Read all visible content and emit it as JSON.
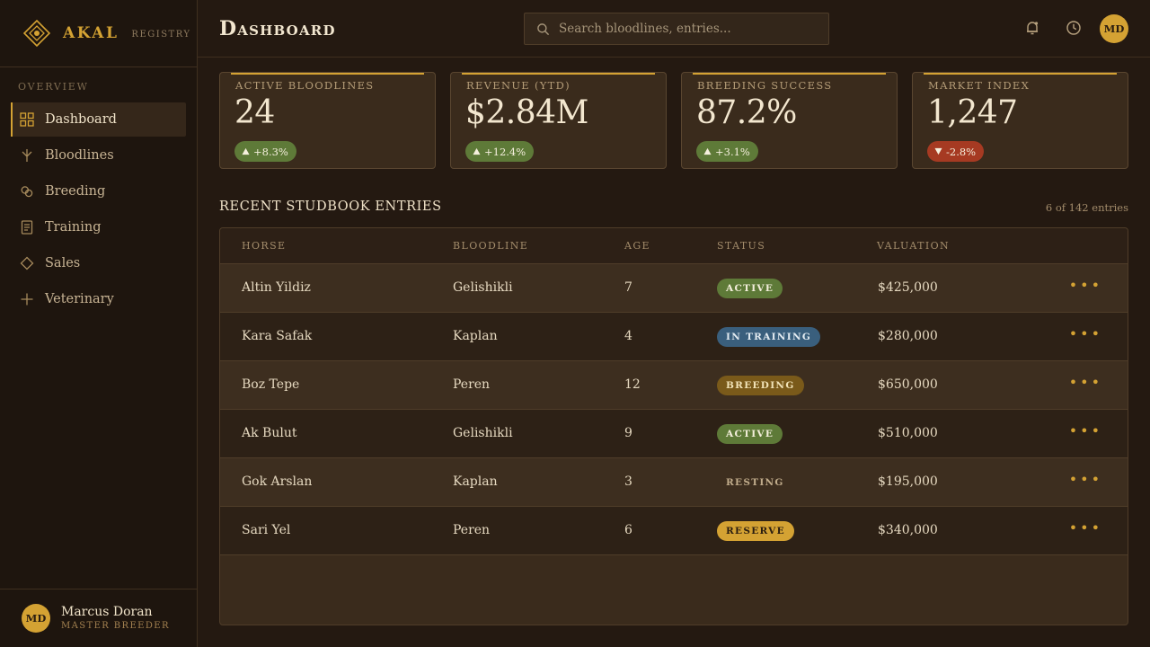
{
  "brand": {
    "name": "AKAL",
    "sub": "REGISTRY",
    "logo_icon": "diamond-logo-icon"
  },
  "colors": {
    "accent": "#d4a233",
    "positive": "#5e7a38",
    "negative": "#a63a22",
    "background": "#241911"
  },
  "sidebar": {
    "section_label": "OVERVIEW",
    "items": [
      {
        "label": "Dashboard",
        "icon": "grid-icon",
        "active": true
      },
      {
        "label": "Bloodlines",
        "icon": "branch-icon",
        "active": false
      },
      {
        "label": "Breeding",
        "icon": "rings-icon",
        "active": false
      },
      {
        "label": "Training",
        "icon": "document-icon",
        "active": false
      },
      {
        "label": "Sales",
        "icon": "diamond-icon",
        "active": false
      },
      {
        "label": "Veterinary",
        "icon": "plus-icon",
        "active": false
      }
    ],
    "user": {
      "initials": "MD",
      "name": "Marcus Doran",
      "role": "MASTER BREEDER"
    }
  },
  "header": {
    "title": "Dashboard",
    "search_placeholder": "Search bloodlines, entries...",
    "user_initials": "MD"
  },
  "stats": [
    {
      "label": "ACTIVE BLOODLINES",
      "value": "24",
      "delta": "+8.3%",
      "trend": "up"
    },
    {
      "label": "REVENUE (YTD)",
      "value": "$2.84M",
      "delta": "+12.4%",
      "trend": "up"
    },
    {
      "label": "BREEDING SUCCESS",
      "value": "87.2%",
      "delta": "+3.1%",
      "trend": "up"
    },
    {
      "label": "MARKET INDEX",
      "value": "1,247",
      "delta": "-2.8%",
      "trend": "down"
    }
  ],
  "table": {
    "title": "RECENT STUDBOOK ENTRIES",
    "count": "6 of 142 entries",
    "columns": [
      "HORSE",
      "BLOODLINE",
      "AGE",
      "STATUS",
      "VALUATION"
    ],
    "rows": [
      {
        "horse": "Altin Yildiz",
        "bloodline": "Gelishikli",
        "age": "7",
        "status": "ACTIVE",
        "valuation": "$425,000"
      },
      {
        "horse": "Kara Safak",
        "bloodline": "Kaplan",
        "age": "4",
        "status": "IN TRAINING",
        "valuation": "$280,000"
      },
      {
        "horse": "Boz Tepe",
        "bloodline": "Peren",
        "age": "12",
        "status": "BREEDING",
        "valuation": "$650,000"
      },
      {
        "horse": "Ak Bulut",
        "bloodline": "Gelishikli",
        "age": "9",
        "status": "ACTIVE",
        "valuation": "$510,000"
      },
      {
        "horse": "Gok Arslan",
        "bloodline": "Kaplan",
        "age": "3",
        "status": "RESTING",
        "valuation": "$195,000"
      },
      {
        "horse": "Sari Yel",
        "bloodline": "Peren",
        "age": "6",
        "status": "RESERVE",
        "valuation": "$340,000"
      }
    ],
    "row_action": "•••"
  }
}
